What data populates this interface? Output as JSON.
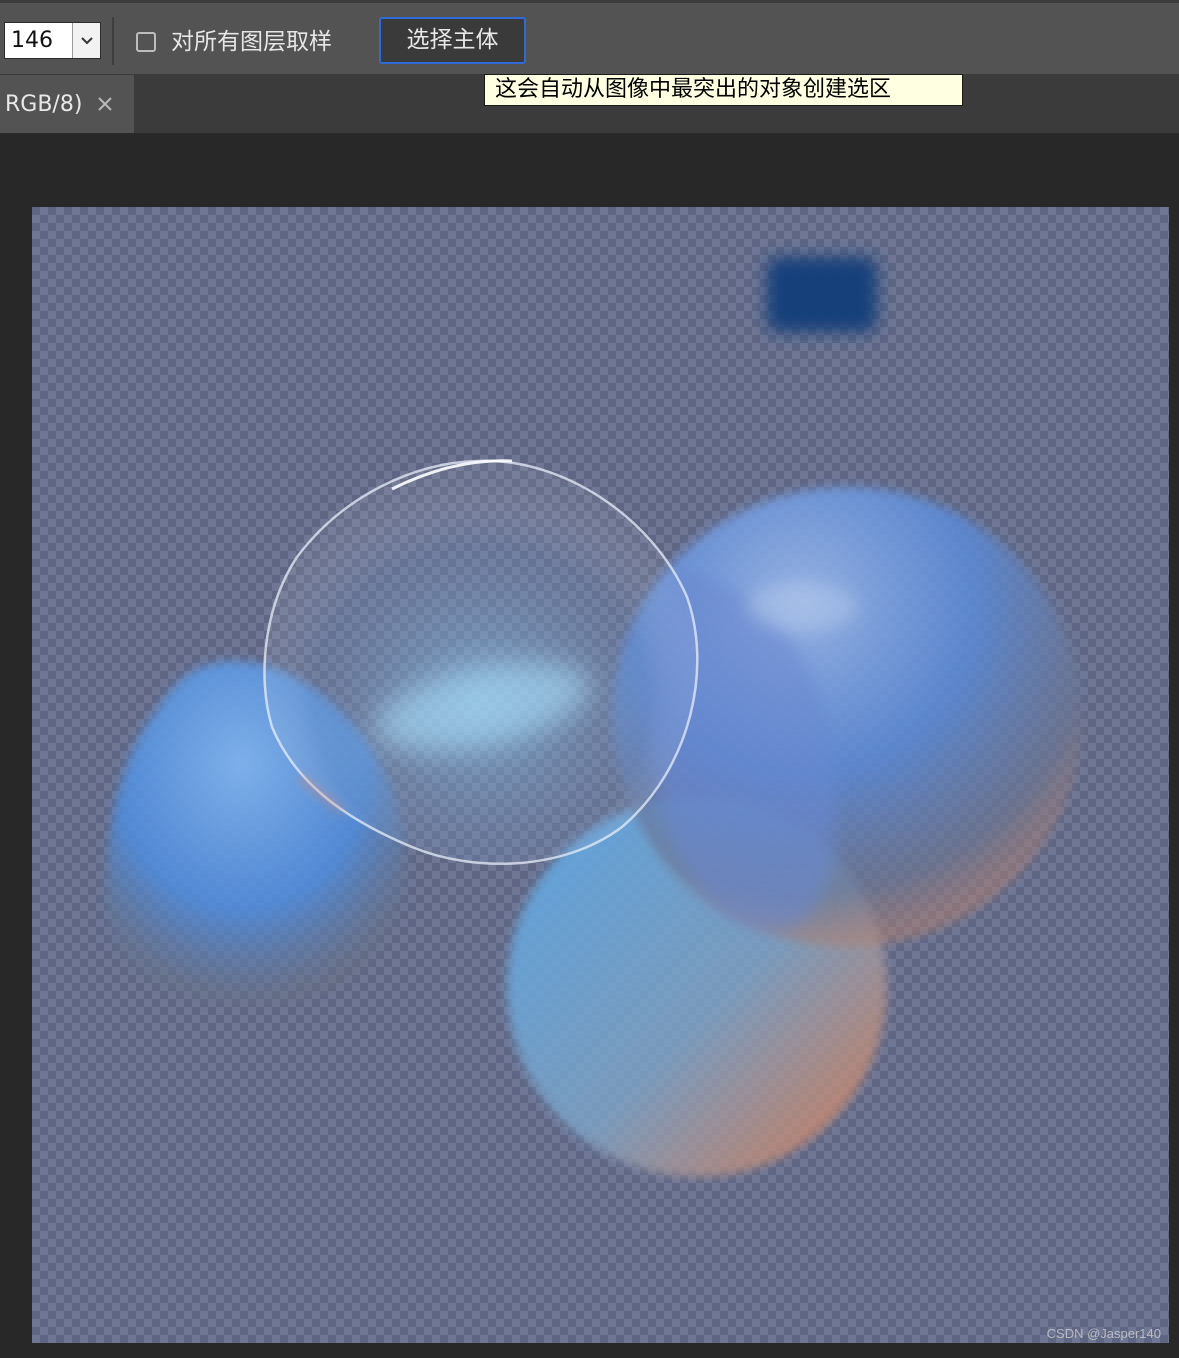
{
  "options_bar": {
    "tolerance_value": "146",
    "sample_all_layers": {
      "label": "对所有图层取样",
      "checked": false
    },
    "select_subject_button": "选择主体",
    "tooltip": "这会自动从图像中最突出的对象创建选区"
  },
  "tabs": [
    {
      "title": "RGB/8)",
      "active": true
    }
  ],
  "icons": {
    "dropdown": "chevron-down-icon",
    "close": "close-icon"
  },
  "colors": {
    "ui_panel": "#535353",
    "canvas_bg": "#282828",
    "button_focus": "#2f6ad6",
    "tooltip_bg": "#ffffe1"
  },
  "canvas": {
    "watermark": "CSDN @Jasper140"
  }
}
